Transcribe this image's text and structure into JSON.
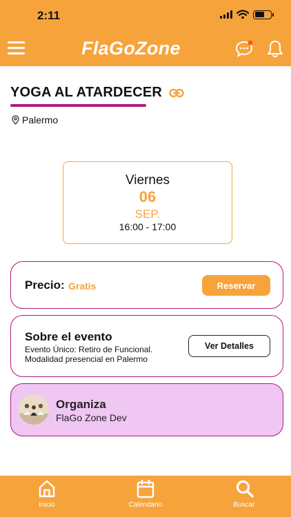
{
  "status_bar": {
    "time": "2:11"
  },
  "header": {
    "brand": "FlaGoZone"
  },
  "event": {
    "title": "YOGA AL ATARDECER",
    "location": "Palermo",
    "date": {
      "weekday": "Viernes",
      "day": "06",
      "month": "SEP.",
      "time": "16:00 - 17:00"
    },
    "price_label": "Precio:",
    "price_value": "Gratis",
    "reserve_label": "Reservar",
    "about_title": "Sobre el evento",
    "about_desc": "Evento Único: Retiro de Funcional. Modalidad presencial en Palermo",
    "details_label": "Ver Detalles",
    "organizer_label": "Organiza",
    "organizer_name": "FlaGo Zone Dev"
  },
  "bottom_nav": [
    {
      "label": "Inicio",
      "icon": "home-icon"
    },
    {
      "label": "Calendario",
      "icon": "calendar-icon"
    },
    {
      "label": "Buscar",
      "icon": "search-icon"
    }
  ],
  "colors": {
    "primary": "#f7a33c",
    "accent": "#b0197e",
    "organizer_bg": "#f0c6f3"
  },
  "icons": [
    "menu-icon",
    "chat-icon",
    "bell-icon",
    "link-icon",
    "location-pin-icon",
    "wifi-icon",
    "signal-icon",
    "battery-icon"
  ]
}
